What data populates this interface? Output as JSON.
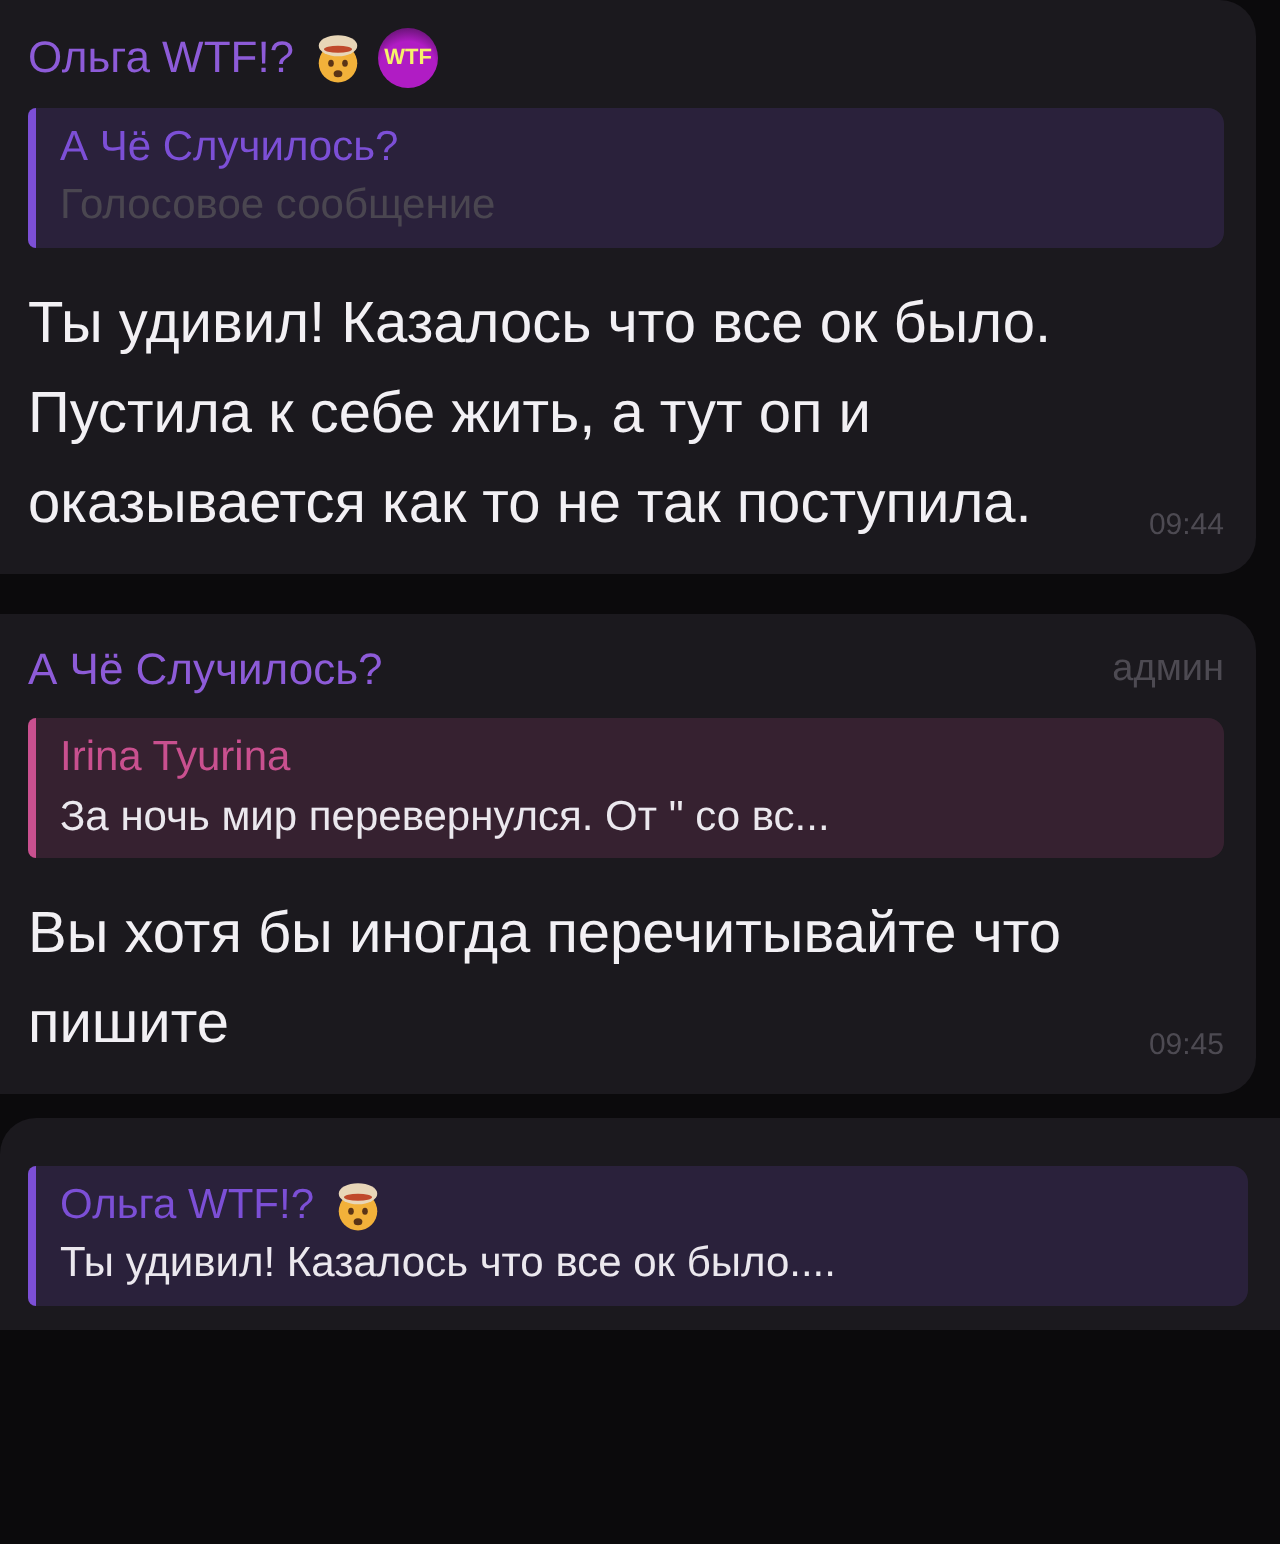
{
  "messages": [
    {
      "sender": "Ольга WTF!?",
      "sender_emoji": true,
      "sender_badge": "WTF",
      "reply": {
        "author": "А Чё Случилось?",
        "author_emoji": false,
        "kind": "voice",
        "text": "Голосовое сообщение",
        "color": "#7c4fd6"
      },
      "text": "Ты удивил! Казалось что все ок было. Пустила к себе жить, а тут оп и оказывается как то не так поступила.",
      "time": "09:44"
    },
    {
      "sender": "А Чё Случилось?",
      "sender_emoji": false,
      "role": "админ",
      "reply": {
        "author": "Irina Tyurina",
        "author_emoji": false,
        "kind": "text",
        "text": "За ночь мир перевернулся. От \" со вс...",
        "color": "#c9508f"
      },
      "text": "Вы хотя бы иногда перечитывайте что пишите",
      "time": "09:45"
    },
    {
      "reply": {
        "author": "Ольга WTF!?",
        "author_emoji": true,
        "kind": "text",
        "text": "Ты удивил! Казалось что все ок было....",
        "color": "#7c4fd6"
      }
    }
  ]
}
